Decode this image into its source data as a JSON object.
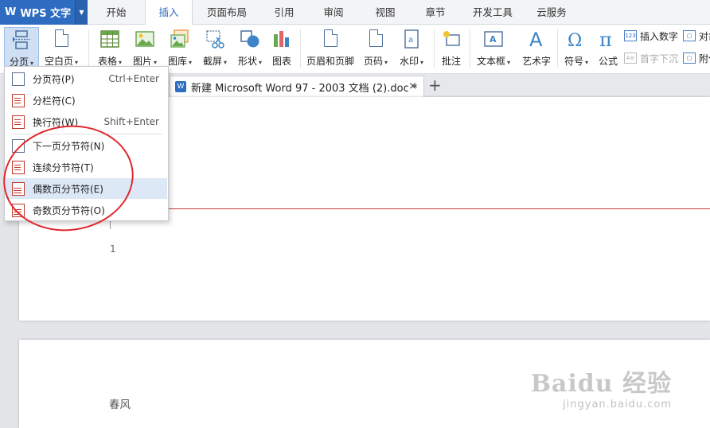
{
  "app": {
    "name": "WPS 文字",
    "logo": "W"
  },
  "menu_tabs": [
    {
      "label": "开始",
      "w": 72
    },
    {
      "label": "插入",
      "w": 60,
      "active": true
    },
    {
      "label": "页面布局",
      "w": 86
    },
    {
      "label": "引用",
      "w": 58
    },
    {
      "label": "审阅",
      "w": 66
    },
    {
      "label": "视图",
      "w": 64
    },
    {
      "label": "章节",
      "w": 62
    },
    {
      "label": "开发工具",
      "w": 82
    },
    {
      "label": "云服务",
      "w": 66
    }
  ],
  "ribbon": {
    "page_break": "分页",
    "blank_page": "空白页",
    "table": "表格",
    "picture": "图片",
    "gallery": "图库",
    "screenshot": "截屏",
    "shape": "形状",
    "chart": "图表",
    "header_footer": "页眉和页脚",
    "page_number": "页码",
    "watermark": "水印",
    "comment": "批注",
    "textbox": "文本框",
    "wordart": "艺术字",
    "symbol": "符号",
    "formula": "公式",
    "insert_number": "插入数字",
    "object": "对象",
    "drop_cap": "首字下沉",
    "attachment": "附件"
  },
  "doc_tab": {
    "title": "新建 Microsoft Word 97 - 2003 文档 (2).doc *",
    "close": "×",
    "new_tab": "+"
  },
  "dropdown": {
    "items": [
      {
        "label": "分页符(P)",
        "shortcut": "Ctrl+Enter"
      },
      {
        "label": "分栏符(C)",
        "shortcut": ""
      },
      {
        "label": "换行符(W)",
        "shortcut": "Shift+Enter"
      },
      {
        "label": "下一页分节符(N)",
        "shortcut": ""
      },
      {
        "label": "连续分节符(T)",
        "shortcut": ""
      },
      {
        "label": "偶数页分节符(E)",
        "shortcut": ""
      },
      {
        "label": "奇数页分节符(O)",
        "shortcut": ""
      }
    ]
  },
  "document": {
    "page_number": "1",
    "page2_text": "春风"
  },
  "watermark": {
    "brand": "Baidu 经验",
    "url": "jingyan.baidu.com"
  },
  "colors": {
    "accent": "#2d6cc0",
    "annotation": "#e0272c",
    "section_line": "#c43a3a"
  }
}
